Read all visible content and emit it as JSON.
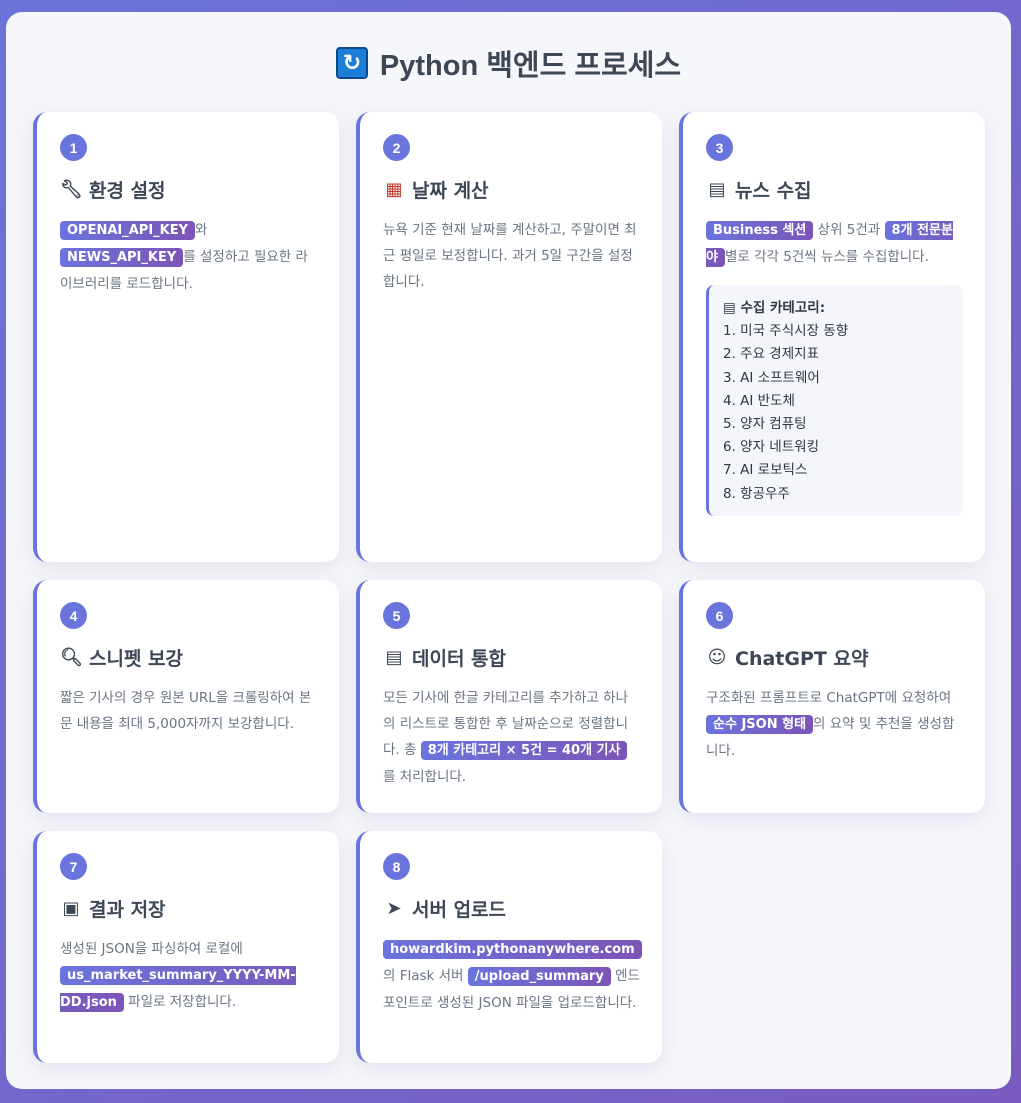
{
  "header": {
    "icon": "refresh-icon",
    "title": "Python 백엔드 프로세스"
  },
  "cards": [
    {
      "num": "1",
      "icon": "wrench-icon",
      "title": "환경 설정",
      "tag1": "OPENAI_API_KEY",
      "t1": "와",
      "tag2": "NEWS_API_KEY",
      "t2": "를 설정하고 필요한 라이브러리를 로드합니다."
    },
    {
      "num": "2",
      "icon": "calendar-icon",
      "title": "날짜 계산",
      "text": "뉴욕 기준 현재 날짜를 계산하고, 주말이면 최근 평일로 보정합니다. 과거 5일 구간을 설정합니다."
    },
    {
      "num": "3",
      "icon": "newspaper-icon",
      "title": "뉴스 수집",
      "tag1": "Business 섹션",
      "t1": " 상위 5건과 ",
      "tag2": "8개 전문분야",
      "t2": "별로 각각 5건씩 뉴스를 수집합니다.",
      "cat_title": "수집 카테고리:",
      "categories": [
        "1. 미국 주식시장 동향",
        "2. 주요 경제지표",
        "3. AI 소프트웨어",
        "4. AI 반도체",
        "5. 양자 컴퓨팅",
        "6. 양자 네트워킹",
        "7. AI 로보틱스",
        "8. 항공우주"
      ]
    },
    {
      "num": "4",
      "icon": "magnifier-icon",
      "title": "스니펫 보강",
      "text": "짧은 기사의 경우 원본 URL을 크롤링하여 본문 내용을 최대 5,000자까지 보강합니다."
    },
    {
      "num": "5",
      "icon": "clipboard-icon",
      "title": "데이터 통합",
      "t0": "모든 기사에 한글 카테고리를 추가하고 하나의 리스트로 통합한 후 날짜순으로 정렬합니다. 총 ",
      "tag1": "8개 카테고리 × 5건 = 40개 기사",
      "t1": " 를 처리합니다."
    },
    {
      "num": "6",
      "icon": "robot-icon",
      "title": "ChatGPT 요약",
      "t0": "구조화된 프롬프트로 ChatGPT에 요청하여 ",
      "tag1": "순수 JSON 형태",
      "t1": "의 요약 및 추천을 생성합니다."
    },
    {
      "num": "7",
      "icon": "floppy-disk-icon",
      "title": "결과 저장",
      "t0": "생성된 JSON을 파싱하여 로컬에 ",
      "tag1": "us_market_summary_YYYY-MM-DD.json",
      "t1": " 파일로 저장합니다."
    },
    {
      "num": "8",
      "icon": "rocket-icon",
      "title": "서버 업로드",
      "tag1": "howardkim.pythonanywhere.com",
      "t1": "의 Flask 서버 ",
      "tag2": "/upload_summary",
      "t2": " 엔드포인트로 생성된 JSON 파일을 업로드합니다."
    }
  ]
}
